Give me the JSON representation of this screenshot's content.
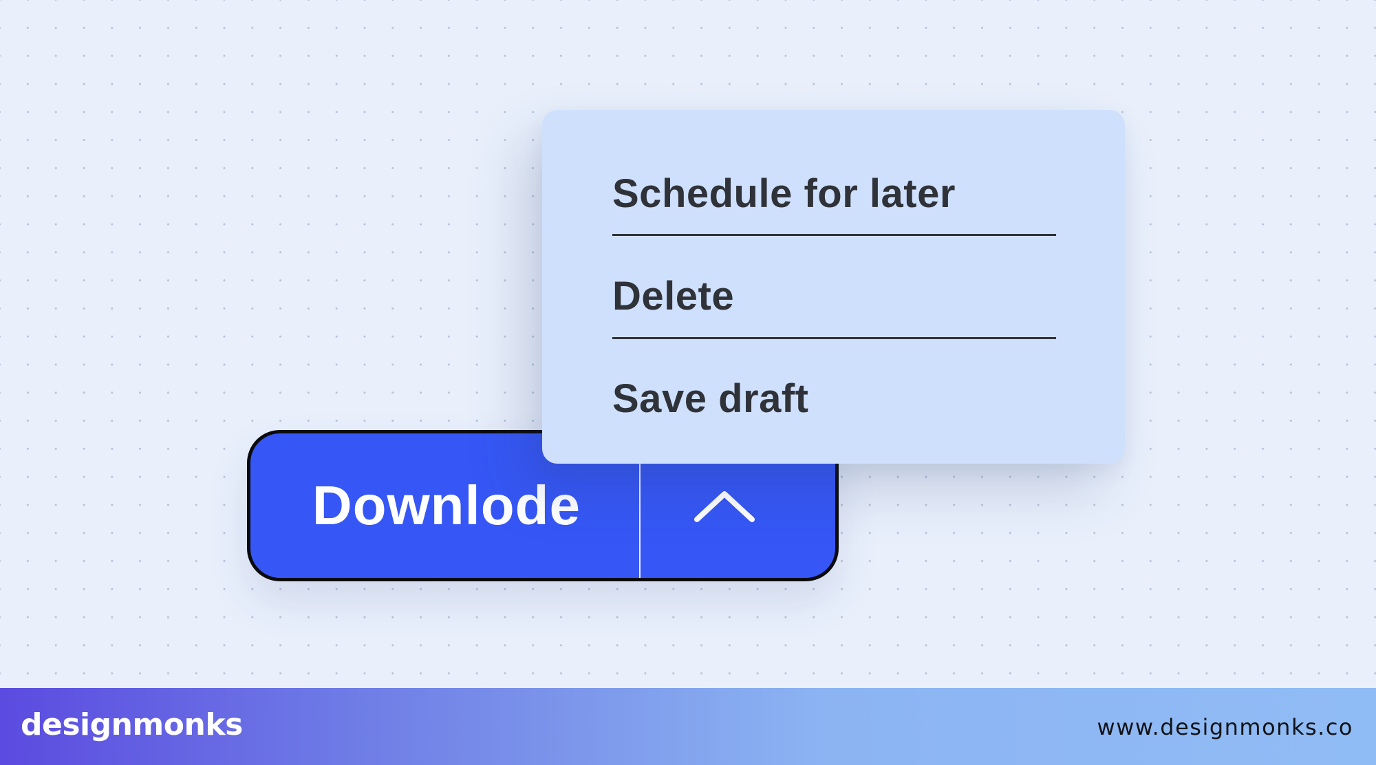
{
  "dropdown": {
    "items": [
      {
        "label": "Schedule for later"
      },
      {
        "label": "Delete"
      },
      {
        "label": "Save draft"
      }
    ]
  },
  "split_button": {
    "main_label": "Downlode",
    "toggle_icon": "chevron-up-icon",
    "accent_color": "#3657f5"
  },
  "footer": {
    "brand": "designmonks",
    "url": "www.designmonks.co"
  }
}
